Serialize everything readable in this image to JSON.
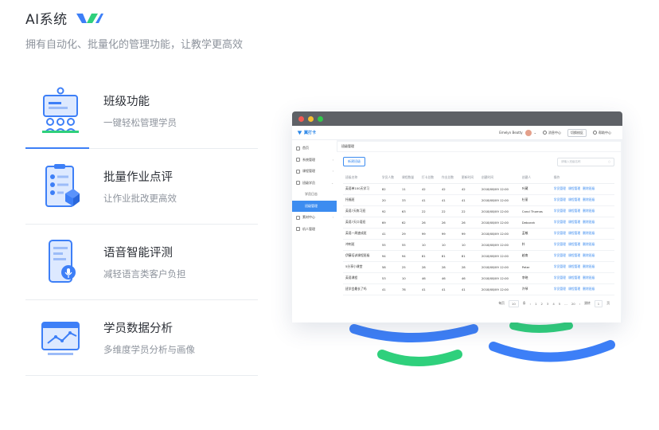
{
  "header": {
    "title": "AI系统",
    "subtitle": "拥有自动化、批量化的管理功能，让教学更高效"
  },
  "features": [
    {
      "title": "班级功能",
      "desc": "一键轻松管理学员",
      "icon": "classroom-icon",
      "active": true
    },
    {
      "title": "批量作业点评",
      "desc": "让作业批改更高效",
      "icon": "clipboard-check-icon",
      "active": false
    },
    {
      "title": "语音智能评测",
      "desc": "减轻语言类客户负担",
      "icon": "phone-voice-icon",
      "active": false
    },
    {
      "title": "学员数据分析",
      "desc": "多维度学员分析与画像",
      "icon": "analytics-chart-icon",
      "active": false
    }
  ],
  "colors": {
    "accent": "#3d7ff7",
    "accent_green": "#2fd07c",
    "window_titlebar": "#5e6166",
    "sidebar_selected": "#3c8cf0"
  },
  "app": {
    "brand": "翼打卡",
    "user": "Emelyn Beatty",
    "topbar_links": [
      "消息中心",
      "帮助中心"
    ],
    "topbar_button": "切换校区",
    "sidebar": [
      {
        "label": "首页",
        "type": "top"
      },
      {
        "label": "系统管理",
        "type": "top",
        "arrow": "›"
      },
      {
        "label": "课程管理",
        "type": "top",
        "arrow": "›"
      },
      {
        "label": "班级学员",
        "type": "top",
        "arrow": "⌄"
      },
      {
        "label": "学员日志",
        "type": "sub"
      },
      {
        "label": "班级管理",
        "type": "sub",
        "selected": true
      },
      {
        "label": "素材中心",
        "type": "top",
        "arrow": "›"
      },
      {
        "label": "机人管理",
        "type": "top"
      }
    ],
    "breadcrumb": "班级管理",
    "add_button": "新建班级",
    "search_placeholder": "请输入班级名称",
    "table": {
      "headers": [
        "班级名称",
        "学员人数",
        "课程数量",
        "打卡总数",
        "作业总数",
        "更新时间",
        "创建时间",
        "创建人",
        "操作"
      ],
      "ops": [
        "学员管理",
        "课程管理",
        "删除班级"
      ],
      "rows": [
        [
          "英语单100天学习",
          "82",
          "11",
          "42",
          "42",
          "42",
          "2018/08/09 12:00",
          "叶藏"
        ],
        [
          "托福班",
          "20",
          "33",
          "41",
          "41",
          "41",
          "2018/08/09 12:00",
          "杜丽"
        ],
        [
          "英语7天练习班",
          "92",
          "63",
          "22",
          "22",
          "22",
          "2018/08/09 12:00",
          "Carol Thomas"
        ],
        [
          "英语7天口语班",
          "69",
          "62",
          "26",
          "26",
          "26",
          "2018/08/09 12:00",
          "Deborah"
        ],
        [
          "英语一周速成班",
          "41",
          "29",
          "99",
          "99",
          "99",
          "2018/08/09 12:00",
          "孟敏"
        ],
        [
          "冲刺班",
          "55",
          "55",
          "10",
          "10",
          "10",
          "2018/08/09 12:00",
          "朴"
        ],
        [
          "伊藤培训课程班级",
          "94",
          "94",
          "81",
          "81",
          "81",
          "2018/08/09 12:00",
          "越南"
        ],
        [
          "5分享小课堂",
          "58",
          "25",
          "28",
          "28",
          "28",
          "2018/08/09 12:00",
          "Peter"
        ],
        [
          "英语课程",
          "53",
          "10",
          "46",
          "46",
          "46",
          "2018/08/09 12:00",
          "李晓"
        ],
        [
          "班学会最长了吗",
          "41",
          "78",
          "41",
          "41",
          "41",
          "2018/08/09 12:00",
          "许琴"
        ]
      ]
    },
    "pager": {
      "per_page_label": "每页",
      "per_page": "10",
      "per_page_unit": "条",
      "pages": [
        "1",
        "2",
        "3",
        "4",
        "5",
        "...",
        "20"
      ],
      "goto_label": "跳转",
      "goto_value": "1",
      "goto_unit": "页"
    }
  }
}
